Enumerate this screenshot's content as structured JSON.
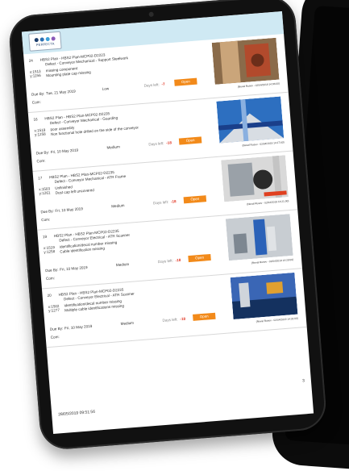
{
  "report": {
    "logo_text": "PERFECTA",
    "footer_date": "28/05/2019 09:51:56",
    "page_number": "3",
    "labels": {
      "due_by": "Due By:",
      "comment": "Com:",
      "days_left": "Days left:"
    },
    "items": [
      {
        "num": "24",
        "title": "HBS2 Plan - HBS2 Plan-MCP02-D2223",
        "subtitle": "Defect - Conveyor Mechanical - Support Steelwork",
        "x": "x:1513",
        "y": "y:1156",
        "desc": [
          "missing component",
          "Mounting plate cap missing"
        ],
        "due_date": "Tue, 21 May 2019",
        "priority": "Low",
        "days_left": "-7",
        "status": "Open",
        "photo_caption": "(Neval Rusev - 02/04/2019 14:06:00)"
      },
      {
        "num": "16",
        "title": "HBS2 Plan - HBS2 Plan-MCP02-D2235",
        "subtitle": "Defect - Conveyor Mechanical - Guarding",
        "x": "x:1519",
        "y": "y:1258",
        "desc": [
          "poor assembly",
          "Non functional hole drilled on the side of the conveyor"
        ],
        "due_date": "Fri, 10 May 2019",
        "priority": "Medium",
        "days_left": "-18",
        "status": "Open",
        "photo_caption": "(Neval Rusev - 02/04/2019 14:17:00)"
      },
      {
        "num": "17",
        "title": "HBS2 Plan - HBS2 Plan-MCP02-D2235",
        "subtitle": "Defect - Conveyor Mechanical - ATR Frame",
        "x": "x:1503",
        "y": "y:1261",
        "desc": [
          "Unfinished",
          "Dust cap left uncovered"
        ],
        "due_date": "Fri, 10 May 2019",
        "priority": "Medium",
        "days_left": "-18",
        "status": "Open",
        "photo_caption": "(Neval Rusev - 02/04/2019 14:21:00)"
      },
      {
        "num": "19",
        "title": "HBS2 Plan - HBS2 Plan-MCP02-D2235",
        "subtitle": "Defect - Conveyor Electrical - ATR Scanner",
        "x": "x:1519",
        "y": "y:1258",
        "desc": [
          "identification/decal number missing",
          "Cable identification missing"
        ],
        "due_date": "Fri, 10 May 2019",
        "priority": "Medium",
        "days_left": "-18",
        "status": "Open",
        "photo_caption": "(Neval Rusev - 02/04/2019 14:29:00)"
      },
      {
        "num": "20",
        "title": "HBS2 Plan - HBS2 Plan-MCP02-D2235",
        "subtitle": "Defect - Conveyor Electrical - ATR Scanner",
        "x": "x:1502",
        "y": "y:1277",
        "desc": [
          "identification/decal number missing",
          "Multiple cable identifications missing"
        ],
        "due_date": "Fri, 10 May 2019",
        "priority": "Medium",
        "days_left": "-18",
        "status": "Open",
        "photo_caption": "(Neval Rusev - 02/04/2019 14:32:00)"
      }
    ]
  },
  "colors": {
    "header_band": "#cfe9f3",
    "status_open": "#f28a1a",
    "days_overdue": "#e0301e",
    "device_frame": "#111111"
  }
}
